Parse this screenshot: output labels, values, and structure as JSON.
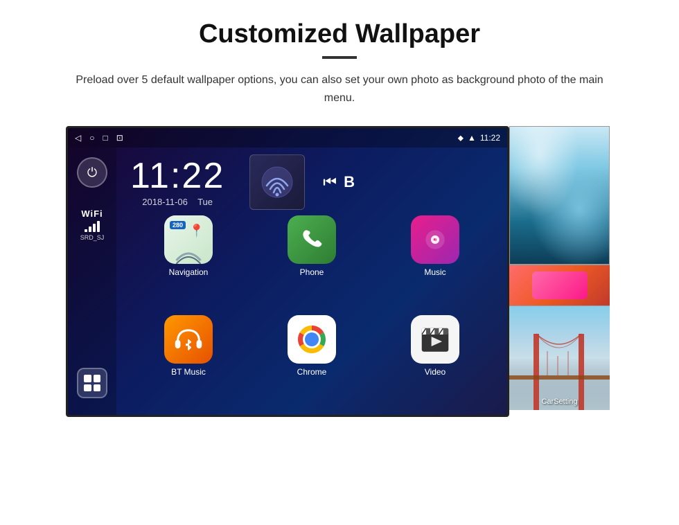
{
  "page": {
    "title": "Customized Wallpaper",
    "subtitle": "Preload over 5 default wallpaper options, you can also set your own photo as background photo of the main menu."
  },
  "device": {
    "statusBar": {
      "time": "11:22",
      "icons": [
        "back-arrow",
        "home-circle",
        "square-recent",
        "screenshot"
      ],
      "rightIcons": [
        "location",
        "wifi",
        "time"
      ]
    },
    "clock": {
      "time": "11:22",
      "date": "2018-11-06",
      "day": "Tue"
    },
    "wifi": {
      "label": "WiFi",
      "ssid": "SRD_SJ"
    },
    "apps": [
      {
        "id": "navigation",
        "label": "Navigation",
        "icon": "map"
      },
      {
        "id": "phone",
        "label": "Phone",
        "icon": "phone"
      },
      {
        "id": "music",
        "label": "Music",
        "icon": "music-note"
      },
      {
        "id": "bt-music",
        "label": "BT Music",
        "icon": "bluetooth"
      },
      {
        "id": "chrome",
        "label": "Chrome",
        "icon": "chrome"
      },
      {
        "id": "video",
        "label": "Video",
        "icon": "video-clapper"
      }
    ],
    "nav": {
      "badge": "280"
    }
  },
  "wallpapers": [
    {
      "id": "ice",
      "label": "Ice/Blue wallpaper"
    },
    {
      "id": "car-setting",
      "label": "CarSetting",
      "sublabel": "CarSetting"
    },
    {
      "id": "bridge",
      "label": "Bridge wallpaper"
    }
  ]
}
